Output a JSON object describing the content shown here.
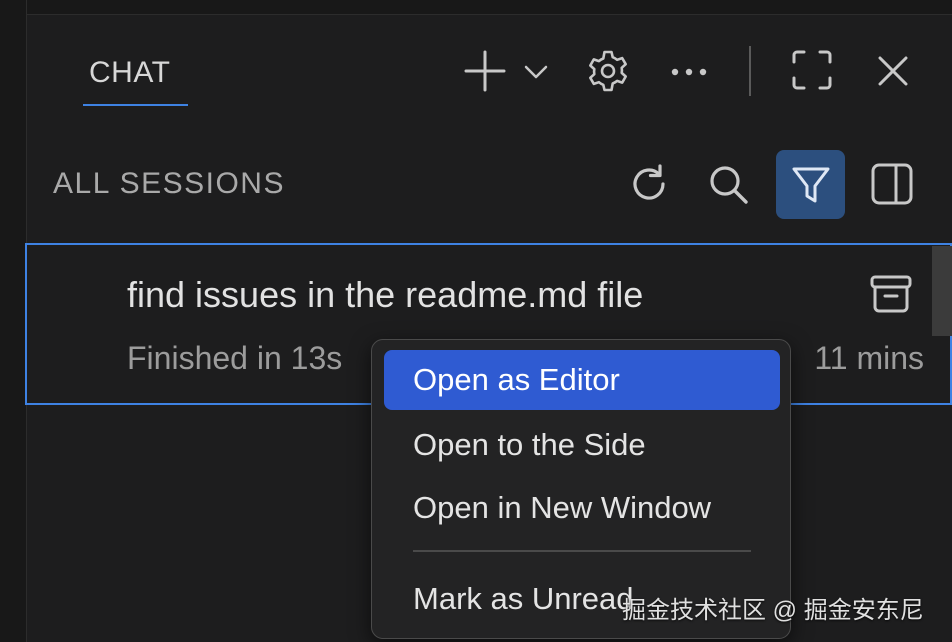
{
  "chat_panel": {
    "tab_label": "CHAT",
    "toolbar_icons": [
      "plus-icon",
      "chevron-down-icon",
      "gear-icon",
      "ellipsis-icon",
      "maximize-icon",
      "close-icon"
    ]
  },
  "sessions": {
    "title": "ALL SESSIONS",
    "toolbar_icons": [
      "refresh-icon",
      "search-icon",
      "filter-icon",
      "split-panel-icon"
    ],
    "items": [
      {
        "title": "find issues in the readme.md file",
        "status": "Finished in 13s",
        "time": "11 mins"
      }
    ]
  },
  "context_menu": {
    "items": [
      {
        "label": "Open as Editor"
      },
      {
        "label": "Open to the Side"
      },
      {
        "label": "Open in New Window"
      },
      {
        "label": "Mark as Unread"
      }
    ]
  },
  "watermark": "掘金技术社区 @ 掘金安东尼",
  "colors": {
    "accent": "#3e82e3",
    "menu_selected": "#2f5bd2",
    "filter_active_bg": "#2c4f7e",
    "background": "#1d1d1e"
  }
}
